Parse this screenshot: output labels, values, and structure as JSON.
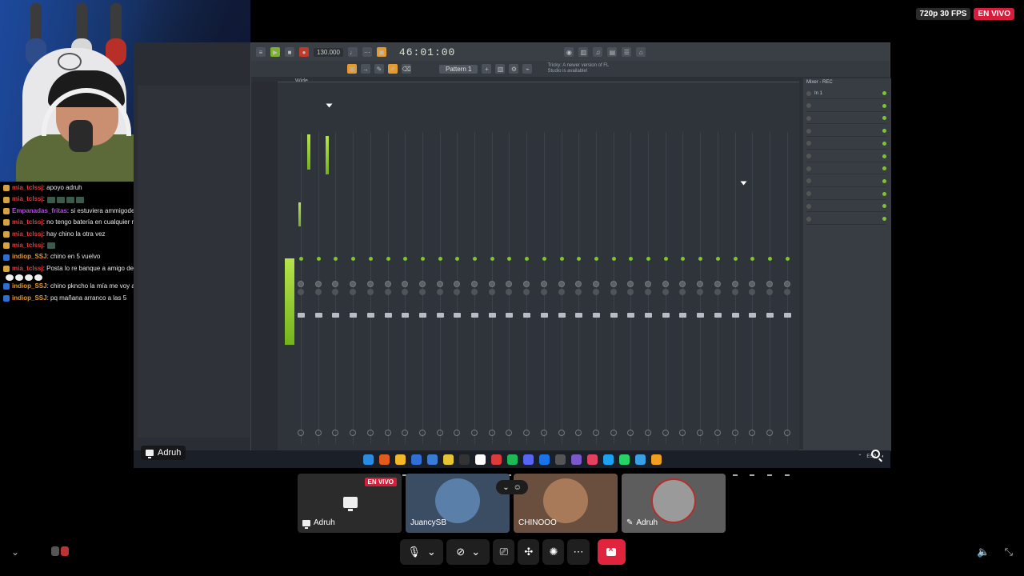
{
  "stream": {
    "quality": "720p 30 FPS",
    "live": "EN VIVO"
  },
  "chat": [
    {
      "user": "mia_tclssj",
      "color": "#e03b3b",
      "msg": ": apoyo adruh",
      "badge": "b1",
      "emotes": 0
    },
    {
      "user": "mia_tclssj",
      "color": "#e03b3b",
      "msg": ":",
      "badge": "b1",
      "emotes": 4
    },
    {
      "user": "Empanadas_fritas",
      "color": "#b24be0",
      "msg": ": si estuviera ammigodeyutub acarrea",
      "badge": "b1",
      "emotes": 0
    },
    {
      "user": "mia_tclssj",
      "color": "#e03b3b",
      "msg": ": no tengo batería en cualquier momento me desaparezco",
      "badge": "b1",
      "emotes": 0
    },
    {
      "user": "mia_tclssj",
      "color": "#e03b3b",
      "msg": ": hay chino la otra vez",
      "badge": "b1",
      "emotes": 0
    },
    {
      "user": "mia_tclssj",
      "color": "#e03b3b",
      "msg": ":",
      "badge": "b1",
      "emotes": 1
    },
    {
      "user": "indiop_SSJ",
      "color": "#e59a2a",
      "msg": ": chino en 5 vuelvo",
      "badge": "b2",
      "emotes": 0
    },
    {
      "user": "mia_tclssj",
      "color": "#e03b3b",
      "msg": ": Posta lo re banque a amigo de YouTube pero bueno JSJKHJAJ",
      "badge": "b1",
      "emotes": 2
    },
    {
      "user": "",
      "color": "#e03b3b",
      "msg": "",
      "badge": "",
      "emotes": 4
    },
    {
      "user": "indiop_SSJ",
      "color": "#e59a2a",
      "msg": ": chino pkncho la mía me voy a dormir",
      "badge": "b2",
      "emotes": 0
    },
    {
      "user": "indiop_SSJ",
      "color": "#e59a2a",
      "msg": ": pq mañana arranco a las 5",
      "badge": "b2",
      "emotes": 0
    }
  ],
  "fl": {
    "time": "46:01:00",
    "bpm": "130.000",
    "pattern": "Pattern 1",
    "hint": "Tricky: A newer version of FL Studio is available!",
    "mixer_title": "Wide",
    "mixer_panel_title": "Mixer - REC",
    "slot_label": "In 1"
  },
  "presenter": "Adruh",
  "participants": [
    {
      "name": "Adruh",
      "live": "EN VIVO",
      "kind": "screen"
    },
    {
      "name": "JuancySB",
      "kind": "camera",
      "color": "#5a7fa8"
    },
    {
      "name": "CHINOOO",
      "kind": "camera",
      "color": "#a87a5a"
    },
    {
      "name": "Adruh",
      "kind": "camera",
      "color": "#9a9a9a",
      "muted": true
    }
  ],
  "icons": {
    "mic": "microphone-icon",
    "camera_off": "camera-off-icon",
    "share": "screen-share-icon",
    "activities": "activities-icon",
    "effects": "effects-icon",
    "more": "more-icon",
    "leave": "leave-call-icon",
    "volume": "volume-icon",
    "fullscreen": "exit-fullscreen-icon"
  }
}
